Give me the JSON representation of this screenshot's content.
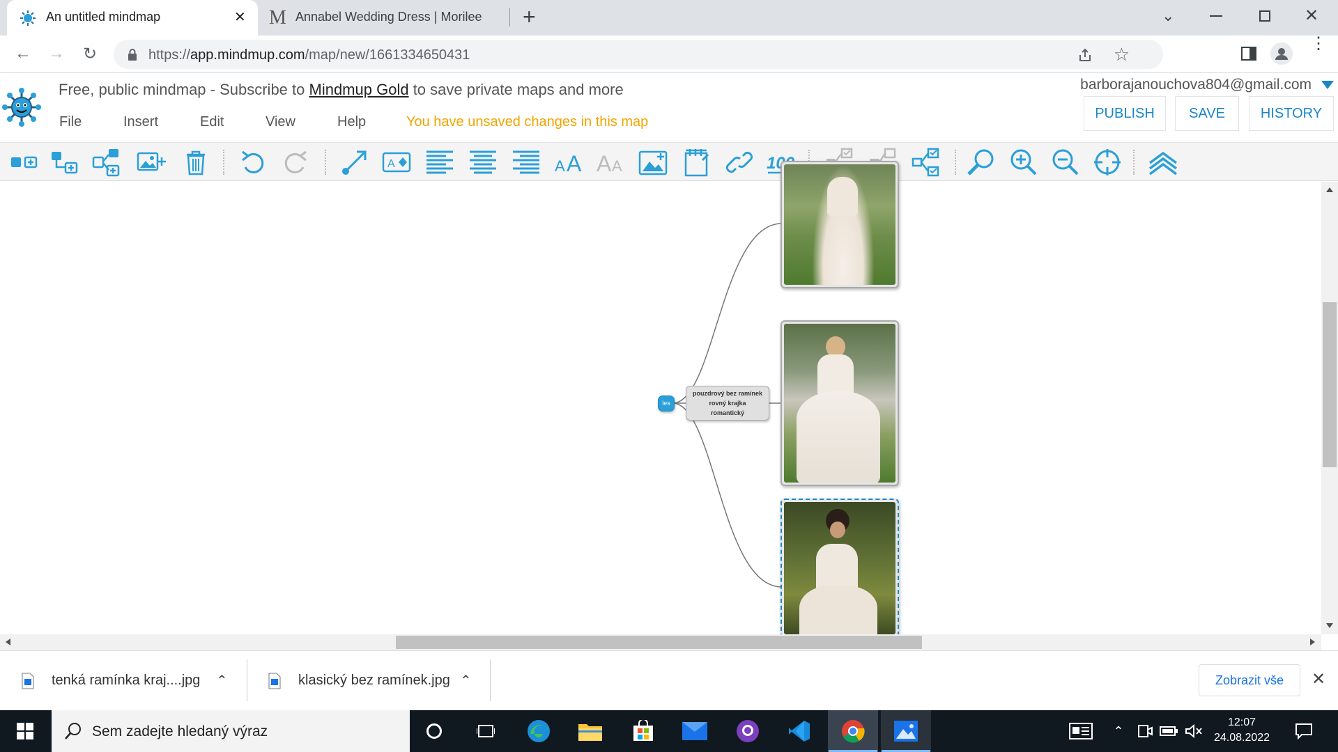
{
  "browser": {
    "tabs": [
      {
        "title": "An untitled mindmap",
        "active": true
      },
      {
        "title": "Annabel Wedding Dress | Morilee",
        "active": false
      }
    ],
    "url_scheme": "https://",
    "url_host": "app.mindmup.com",
    "url_path": "/map/new/1661334650431"
  },
  "app": {
    "tagline_prefix": "Free, public mindmap - Subscribe to ",
    "tagline_link": "Mindmup Gold",
    "tagline_suffix": " to save private maps and more",
    "account_email": "barborajanouchova804@gmail.com",
    "menu": [
      "File",
      "Insert",
      "Edit",
      "View",
      "Help"
    ],
    "unsaved_notice": "You have unsaved changes in this map",
    "buttons": {
      "publish": "PUBLISH",
      "save": "SAVE",
      "history": "HISTORY"
    }
  },
  "toolbar_icons": [
    "add-child-icon",
    "add-sibling-icon",
    "add-parent-icon",
    "insert-image-icon",
    "delete-icon",
    "undo-icon",
    "redo-icon",
    "connect-icon",
    "node-style-icon",
    "align-left-icon",
    "align-center-icon",
    "align-right-icon",
    "text-larger-icon",
    "text-smaller-icon",
    "image-node-icon",
    "note-icon",
    "link-icon",
    "score-icon",
    "collapse-icon",
    "expand-icon",
    "toggle-children-icon",
    "search-icon",
    "zoom-in-icon",
    "zoom-out-icon",
    "center-icon",
    "top-level-icon"
  ],
  "mindmap": {
    "small_node": "les",
    "main_node_lines": [
      "pouzdrový bez ramínek",
      "rovný krajka",
      "romantický"
    ]
  },
  "downloads": {
    "items": [
      {
        "name": "tenká ramínka kraj....jpg"
      },
      {
        "name": "klasický bez ramínek.jpg"
      }
    ],
    "show_all": "Zobrazit vše"
  },
  "taskbar": {
    "search_placeholder": "Sem zadejte hledaný výraz",
    "time": "12:07",
    "date": "24.08.2022"
  },
  "colors": {
    "accent": "#1a86c8",
    "warning": "#f0a500",
    "toolbar_icon": "#2a9fd8"
  }
}
